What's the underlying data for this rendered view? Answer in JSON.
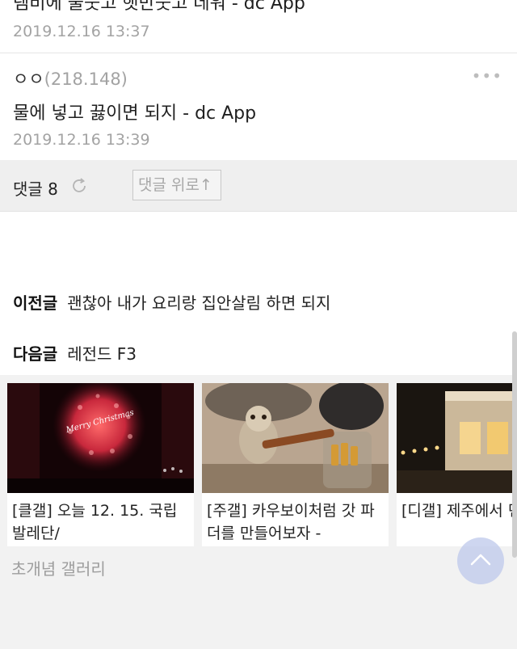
{
  "comments": [
    {
      "text": "렘비에 물붓고 햇반붓고 데워 - dc App",
      "date": "2019.12.16 13:37"
    },
    {
      "author": "ㅇㅇ",
      "ip": "(218.148)",
      "more": "•••",
      "text": "물에 넣고 끓이면 되지 - dc App",
      "date": "2019.12.16 13:39"
    }
  ],
  "comment_bar": {
    "count_label": "댓글 8",
    "up_button": "댓글 위로↑"
  },
  "nav": {
    "prev_label": "이전글",
    "prev_title": "괜찮아 내가 요리랑 집안살림 하면 되지",
    "next_label": "다음글",
    "next_title": "레전드 F3"
  },
  "related": {
    "cards": [
      {
        "title": "[클갤] 오늘 12. 15. 국립 발레단/",
        "thumb_text": "Merry Christmas"
      },
      {
        "title": "[주갤] 카우보이처럼 갓 파더를 만들어보자 -"
      },
      {
        "title": "[디갤] 제주에서 던 숙소"
      }
    ],
    "gallery_name": "초개념 갤러리"
  },
  "colors": {
    "muted": "#a3a3a3",
    "bar_bg": "#efefef",
    "related_bg": "#f2f2f2",
    "top_button": "#bec8eb"
  }
}
